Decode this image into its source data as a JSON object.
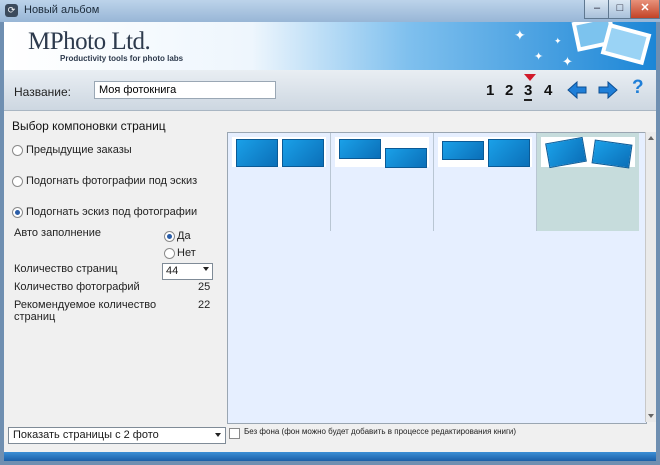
{
  "window": {
    "title": "Новый альбом",
    "icon_glyph": "⟳",
    "minimize_glyph": "–",
    "maximize_glyph": "□",
    "close_glyph": "✕"
  },
  "banner": {
    "logo": "MPhoto Ltd.",
    "tagline": "Productivity tools for photo labs"
  },
  "header": {
    "name_label": "Название:",
    "name_value": "Моя фотокнига",
    "steps": [
      "1",
      "2",
      "3",
      "4"
    ],
    "current_step": 3,
    "icons": [
      "arrow-left-icon",
      "arrow-right-icon",
      "help-icon"
    ],
    "help_glyph": "?"
  },
  "main": {
    "section_title": "Выбор компоновки страниц",
    "options": [
      {
        "label": "Предыдущие заказы",
        "selected": false
      },
      {
        "label": "Подогнать фотографии под эскиз",
        "selected": false
      },
      {
        "label": "Подогнать эскиз под фотографии",
        "selected": true
      }
    ],
    "autofill": {
      "label": "Авто заполнение",
      "yes": "Да",
      "no": "Нет",
      "selected": "yes"
    },
    "pages_count": {
      "label": "Количество страниц",
      "value": "44"
    },
    "photos_count": {
      "label": "Количество фотографий",
      "value": "25"
    },
    "recommended": {
      "label_line1": "Рекомендуемое количество",
      "label_line2": "страниц",
      "value": "22"
    }
  },
  "layouts": {
    "selected_index": 3,
    "count": 4
  },
  "bottom": {
    "show_select": "Показать страницы с 2 фото",
    "no_background_checked": false,
    "no_background_label": "Без фона (фон можно будет добавить в процессе редактирования книги)"
  },
  "colors": {
    "accent": "#1c86d6",
    "step_marker": "#d11a2a",
    "selected_tile": "#c6dcdc"
  }
}
